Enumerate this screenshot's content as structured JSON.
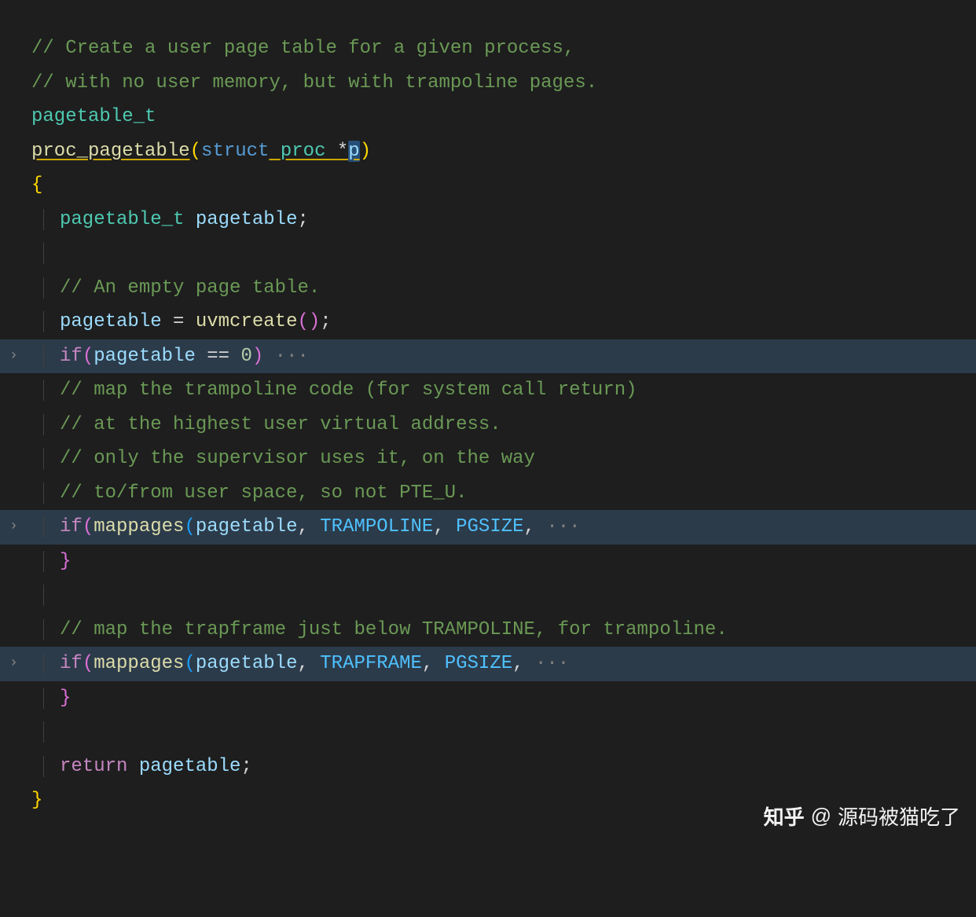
{
  "code": {
    "c1": "// Create a user page table for a given process,",
    "c2": "// with no user memory, but with trampoline pages.",
    "type1": "pagetable_t",
    "fn_name": "proc_pagetable",
    "kw_struct": "struct",
    "proc_type": "proc",
    "star": "*",
    "param_p": "p",
    "brace_open": "{",
    "decl_type": "pagetable_t",
    "decl_var": "pagetable",
    "semi": ";",
    "c3": "// An empty page table.",
    "assign_var": "pagetable",
    "eq": " = ",
    "call_uvm": "uvmcreate",
    "parens": "()",
    "kw_if": "if",
    "cond1_var": "pagetable",
    "cond1_op": " == ",
    "cond1_val": "0",
    "ellipsis": "···",
    "c4": "// map the trampoline code (for system call return)",
    "c5": "// at the highest user virtual address.",
    "c6": "// only the supervisor uses it, on the way",
    "c7": "// to/from user space, so not PTE_U.",
    "call_map": "mappages",
    "arg_pt": "pagetable",
    "arg_tramp": "TRAMPOLINE",
    "arg_pg": "PGSIZE",
    "comma": ",",
    "brace_close": "}",
    "c8": "// map the trapframe just below TRAMPOLINE, for trampoline.",
    "arg_tf": "TRAPFRAME",
    "kw_return": "return",
    "ret_var": "pagetable"
  },
  "watermark": {
    "brand": "知乎",
    "at": "@",
    "author": "源码被猫吃了"
  }
}
